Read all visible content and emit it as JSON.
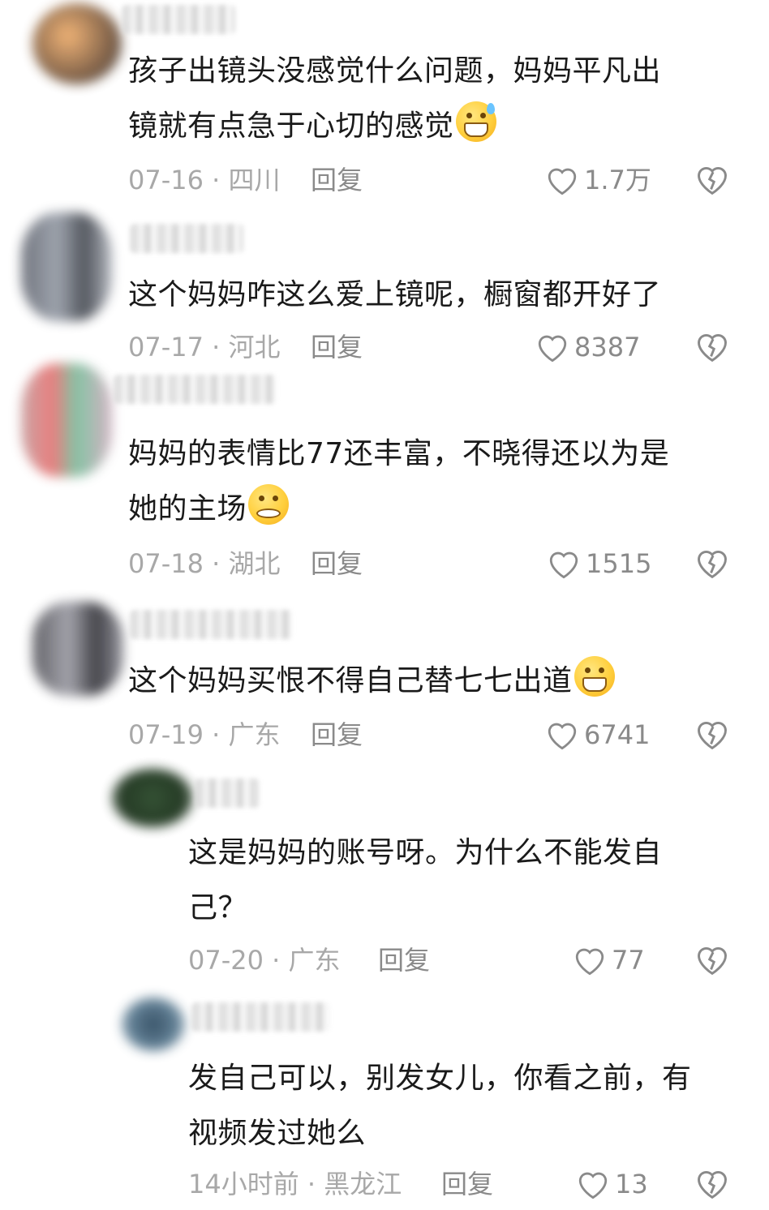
{
  "comments": [
    {
      "text_line1": "孩子出镜头没感觉什么问题，妈妈平凡出",
      "text_line2": "镜就有点急于心切的感觉",
      "emoji": "sweat-grin-emoji",
      "date": "07-16",
      "location": "四川",
      "reply": "回复",
      "likes": "1.7万"
    },
    {
      "text_line1": "这个妈妈咋这么爱上镜呢，橱窗都开好了",
      "date": "07-17",
      "location": "河北",
      "reply": "回复",
      "likes": "8387"
    },
    {
      "text_line1": "妈妈的表情比77还丰富，不晓得还以为是",
      "text_line2": "她的主场",
      "emoji": "pleading-emoji",
      "date": "07-18",
      "location": "湖北",
      "reply": "回复",
      "likes": "1515"
    },
    {
      "text_line1": "这个妈妈买恨不得自己替七七出道",
      "emoji": "grin-emoji",
      "date": "07-19",
      "location": "广东",
      "reply": "回复",
      "likes": "6741"
    },
    {
      "text_line1": "这是妈妈的账号呀。为什么不能发自",
      "text_line2": "己？",
      "date": "07-20",
      "location": "广东",
      "reply": "回复",
      "likes": "77"
    },
    {
      "text_line1": "发自己可以，别发女儿，你看之前，有",
      "text_line2": "视频发过她么",
      "date": "14小时前",
      "location": "黑龙江",
      "reply": "回复",
      "likes": "13"
    }
  ],
  "separator": " · ",
  "colors": {
    "meta": "#a8a8a8",
    "text": "#1a1a1a",
    "icon": "#8a8a8a"
  }
}
